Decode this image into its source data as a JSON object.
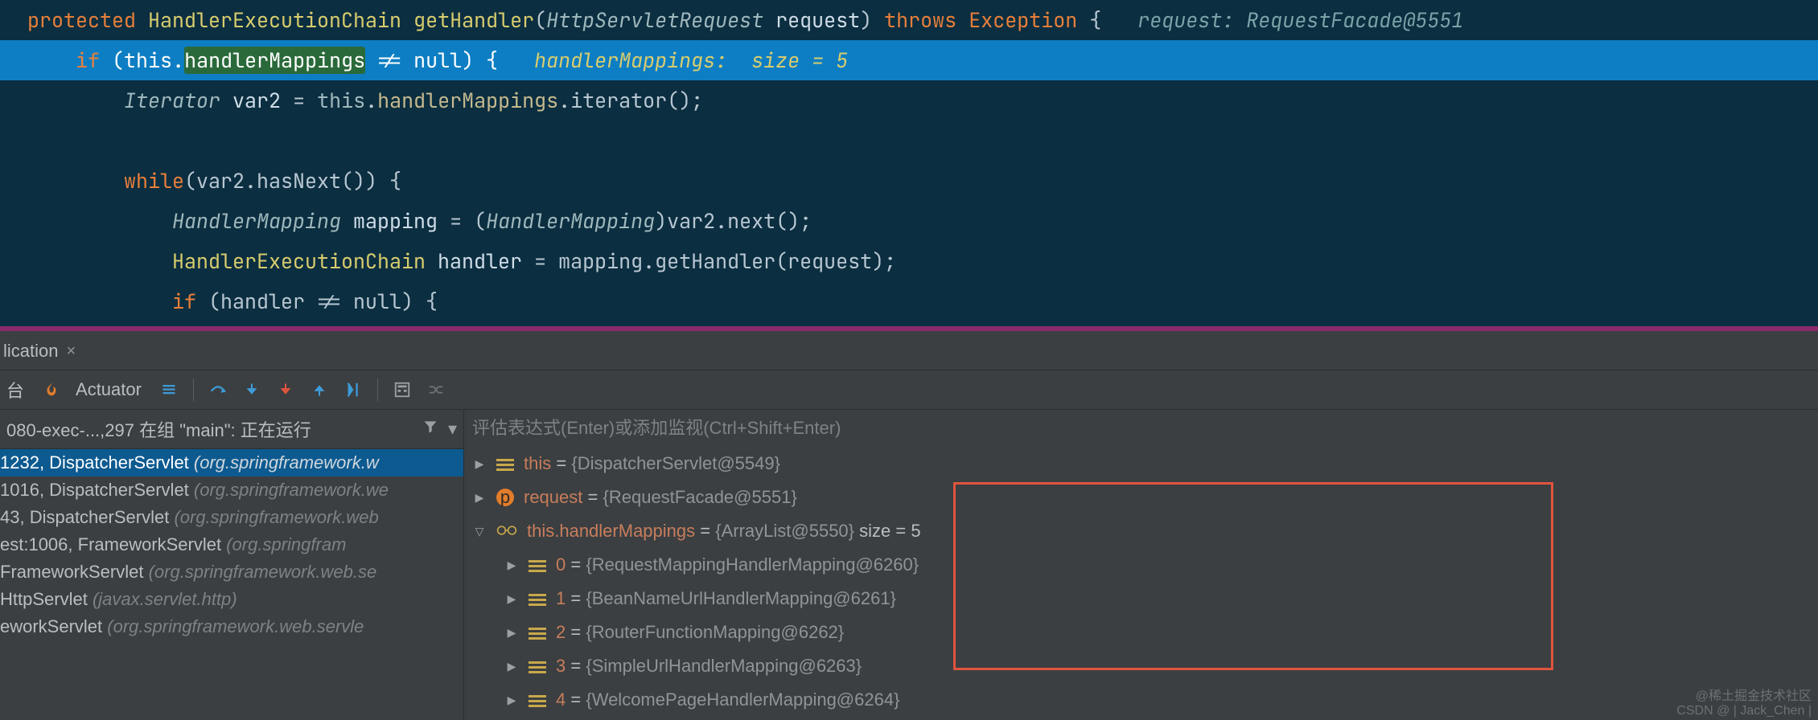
{
  "code": {
    "l1_protected": "protected",
    "l1_rettype": "HandlerExecutionChain",
    "l1_method": "getHandler",
    "l1_paramtype": "HttpServletRequest",
    "l1_paramname": "request",
    "l1_throws": "throws",
    "l1_exc": "Exception",
    "l1_hint": "request: RequestFacade@5551",
    "l2_if": "if",
    "l2_this": "this",
    "l2_field": "handlerMappings",
    "l2_cond": " != null) {",
    "l2_hint": "handlerMappings:  size = 5",
    "l3_type": "Iterator",
    "l3_var": "var2",
    "l3_eq": " = ",
    "l3_this": "this",
    "l3_field": "handlerMappings",
    "l3_call": ".iterator();",
    "l5_while": "while",
    "l5_rest": "(var2.hasNext()) {",
    "l6_type": "HandlerMapping",
    "l6_var": "mapping",
    "l6_mid": " = (",
    "l6_cast": "HandlerMapping",
    "l6_rest": ")var2.next();",
    "l7_type": "HandlerExecutionChain",
    "l7_var": "handler",
    "l7_mid": " = mapping.getHandler(request);",
    "l8_if": "if",
    "l8_rest": " (handler != null) {"
  },
  "tab": {
    "label": "lication",
    "closeGlyph": "×"
  },
  "toolbar": {
    "tai": "台",
    "actuator": "Actuator"
  },
  "inputHint": "评估表达式(Enter)或添加监视(Ctrl+Shift+Enter)",
  "threadRow": "080-exec-...,297 在组 \"main\": 正在运行",
  "stack": [
    {
      "main": "1232, DispatcherServlet ",
      "dim": "(org.springframework.w",
      "sel": true
    },
    {
      "main": "1016, DispatcherServlet ",
      "dim": "(org.springframework.we",
      "sel": false
    },
    {
      "main": "43, DispatcherServlet ",
      "dim": "(org.springframework.web",
      "sel": false
    },
    {
      "main": "est:1006, FrameworkServlet ",
      "dim": "(org.springfram",
      "sel": false
    },
    {
      "main": "FrameworkServlet ",
      "dim": "(org.springframework.web.se",
      "sel": false
    },
    {
      "main": "HttpServlet ",
      "dim": "(javax.servlet.http)",
      "sel": false
    },
    {
      "main": "eworkServlet ",
      "dim": "(org.springframework.web.servle",
      "sel": false
    }
  ],
  "vars": {
    "thisName": "this",
    "thisVal": "{DispatcherServlet@5549}",
    "requestName": "request",
    "requestVal": "{RequestFacade@5551}",
    "mappingsName": "this.handlerMappings",
    "mappingsVal": "{ArrayList@5550}",
    "mappingsSize": " size = 5",
    "items": [
      {
        "idx": "0",
        "val": "{RequestMappingHandlerMapping@6260}"
      },
      {
        "idx": "1",
        "val": "{BeanNameUrlHandlerMapping@6261}"
      },
      {
        "idx": "2",
        "val": "{RouterFunctionMapping@6262}"
      },
      {
        "idx": "3",
        "val": "{SimpleUrlHandlerMapping@6263}"
      },
      {
        "idx": "4",
        "val": "{WelcomePageHandlerMapping@6264}"
      }
    ]
  },
  "watermark": {
    "l1": "@稀土掘金技术社区",
    "l2": "CSDN @ | Jack_Chen |"
  }
}
